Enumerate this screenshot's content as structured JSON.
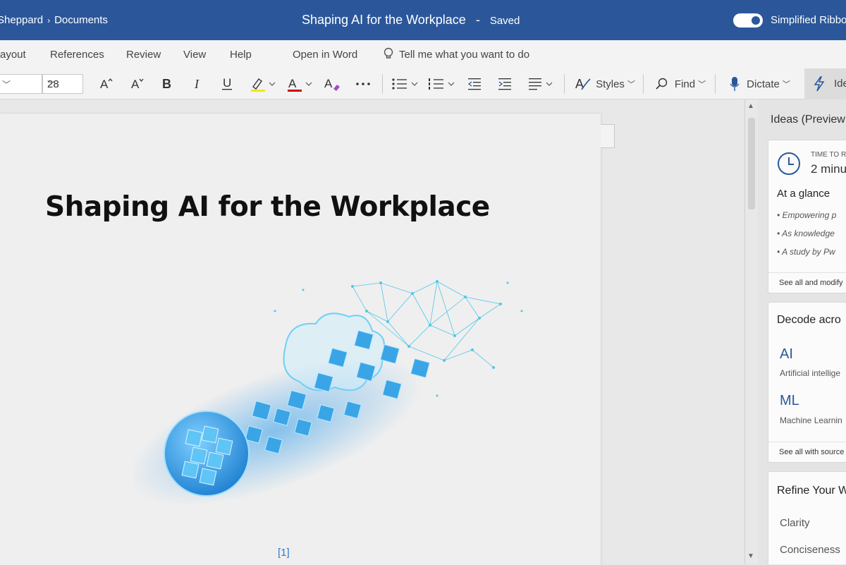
{
  "titlebar": {
    "breadcrumb_user": "Sheppard",
    "breadcrumb_folder": "Documents",
    "doc_title": "Shaping AI for the Workplace",
    "separator": "-",
    "status": "Saved",
    "toggle_label": "Simplified Ribbo"
  },
  "menu": {
    "layout": "ayout",
    "references": "References",
    "review": "Review",
    "view": "View",
    "help": "Help",
    "open_in_word": "Open in Word",
    "tell_me": "Tell me what you want to do"
  },
  "toolbar": {
    "font_size": "28",
    "styles": "Styles",
    "find": "Find",
    "dictate": "Dictate",
    "ideas": "Ide"
  },
  "document": {
    "title": "Shaping AI for the Workplace",
    "footnote": "[1]"
  },
  "ideas_pane": {
    "title": "Ideas (Preview",
    "time_card": {
      "label": "TIME TO R",
      "value": "2 minu",
      "glance_heading": "At a glance",
      "bullets": [
        "Empowering p",
        "As knowledge",
        "A study by Pw"
      ],
      "see_all": "See all and modify"
    },
    "acronym_card": {
      "heading": "Decode acro",
      "items": [
        {
          "acronym": "AI",
          "meaning": "Artificial intellige"
        },
        {
          "acronym": "ML",
          "meaning": "Machine Learnin"
        }
      ],
      "see_all": "See all with source"
    },
    "refine_card": {
      "heading": "Refine Your W",
      "items": [
        "Clarity",
        "Conciseness"
      ]
    }
  },
  "colors": {
    "brand": "#2b579a",
    "accent": "#2b7cd3"
  }
}
